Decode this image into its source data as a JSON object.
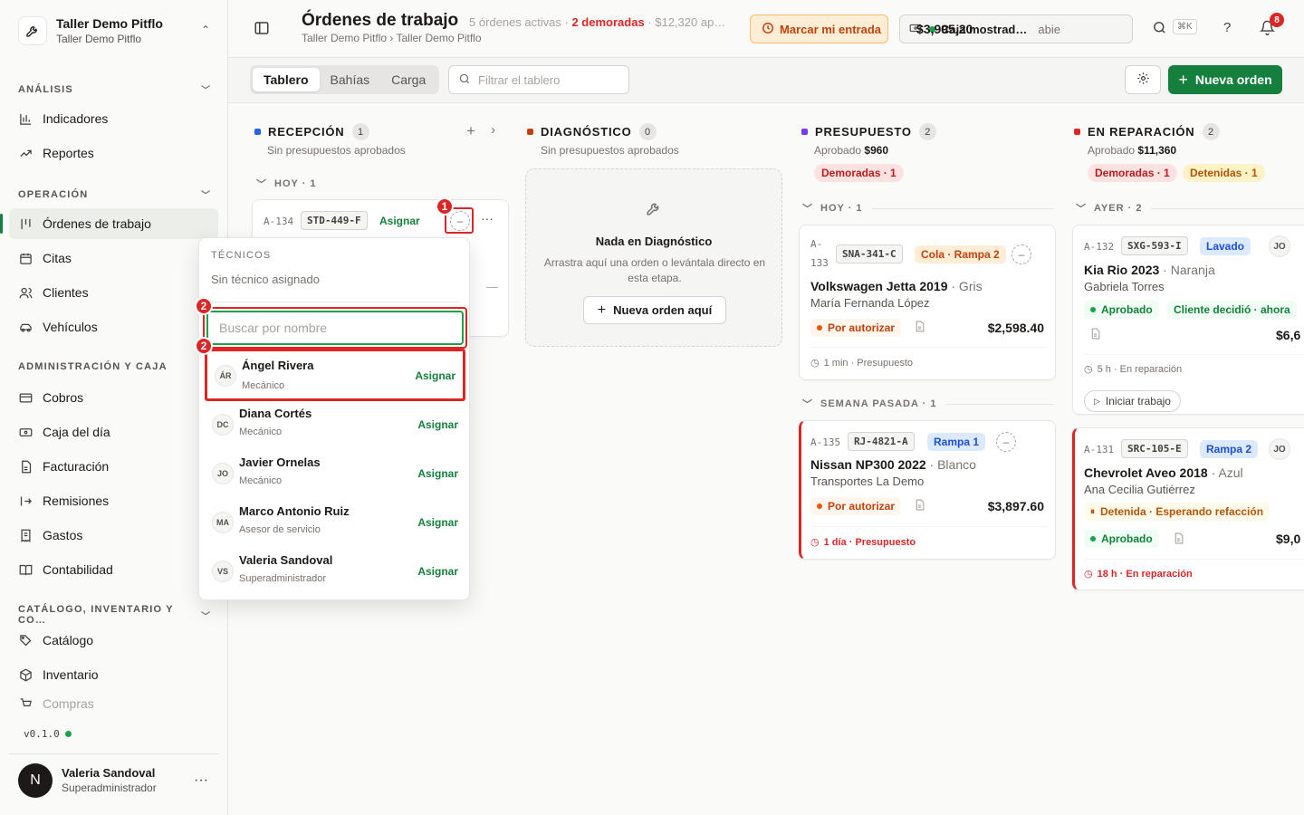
{
  "workspace": {
    "name": "Taller Demo Pitflo",
    "subname": "Taller Demo Pitflo"
  },
  "sidebar": {
    "sections": [
      {
        "label": "ANÁLISIS"
      },
      {
        "label": "OPERACIÓN"
      },
      {
        "label": "ADMINISTRACIÓN Y CAJA"
      },
      {
        "label": "CATÁLOGO, INVENTARIO Y CO…"
      }
    ],
    "items": [
      {
        "label": "Indicadores",
        "icon": "bar-chart-icon"
      },
      {
        "label": "Reportes",
        "icon": "trend-icon"
      },
      {
        "label": "Órdenes de trabajo",
        "icon": "kanban-icon",
        "active": true
      },
      {
        "label": "Citas",
        "icon": "calendar-icon"
      },
      {
        "label": "Clientes",
        "icon": "users-icon"
      },
      {
        "label": "Vehículos",
        "icon": "car-icon"
      },
      {
        "label": "Cobros",
        "icon": "card-icon"
      },
      {
        "label": "Caja del día",
        "icon": "cash-icon"
      },
      {
        "label": "Facturación",
        "icon": "file-icon"
      },
      {
        "label": "Remisiones",
        "icon": "export-icon"
      },
      {
        "label": "Gastos",
        "icon": "receipt-icon"
      },
      {
        "label": "Contabilidad",
        "icon": "book-icon"
      },
      {
        "label": "Catálogo",
        "icon": "tag-icon"
      },
      {
        "label": "Inventario",
        "icon": "box-icon"
      },
      {
        "label": "Compras",
        "icon": "cart-icon"
      }
    ],
    "version": "v0.1.0",
    "user": {
      "initial": "N",
      "name": "Valeria Sandoval",
      "role": "Superadministrador"
    }
  },
  "header": {
    "title": "Órdenes de trabajo",
    "meta_active": "5 órdenes activas ·",
    "meta_late": "2 demoradas",
    "meta_amount": "· $12,320 ap…",
    "breadcrumb": "Taller Demo Pitflo › Taller Demo Pitflo",
    "checkin_label": "Marcar mi entrada",
    "caja_name": "Caja mostrad…",
    "caja_status": "abie",
    "caja_amount": "$3,995.20",
    "kbd": "⌘K",
    "help": "?",
    "notifications": "8"
  },
  "toolbar": {
    "tabs": [
      "Tablero",
      "Bahías",
      "Carga"
    ],
    "filter_placeholder": "Filtrar el tablero",
    "new_label": "Nueva orden"
  },
  "columns": {
    "recepcion": {
      "title": "RECEPCIÓN",
      "count": "1",
      "sub": "Sin presupuestos aprobados",
      "color": "#2563eb",
      "group": "HOY · 1"
    },
    "diagnostico": {
      "title": "DIAGNÓSTICO",
      "count": "0",
      "sub": "Sin presupuestos aprobados",
      "color": "#c2410c",
      "empty_title": "Nada en Diagnóstico",
      "empty_text": "Arrastra aquí una orden o levántala directo en esta etapa.",
      "empty_button": "Nueva orden aquí"
    },
    "presupuesto": {
      "title": "PRESUPUESTO",
      "count": "2",
      "sub_prefix": "Aprobado",
      "sub_amount": "$960",
      "color": "#7c3aed",
      "pill_late": "Demoradas · 1",
      "group1": "HOY · 1",
      "group2": "SEMANA PASADA · 1"
    },
    "reparacion": {
      "title": "EN REPARACIÓN",
      "count": "2",
      "sub_prefix": "Aprobado",
      "sub_amount": "$11,360",
      "color": "#dc2626",
      "pill_late": "Demoradas · 1",
      "pill_held": "Detenidas · 1",
      "group1": "AYER · 2"
    }
  },
  "cards": {
    "a134": {
      "code": "A-134",
      "plate": "STD-449-F",
      "assign": "Asignar"
    },
    "a133": {
      "code_a": "A-",
      "code_b": "133",
      "plate": "SNA-341-C",
      "bay": "Cola · Rampa 2",
      "vehicle": "Volkswagen Jetta 2019",
      "color": "· Gris",
      "client": "María Fernanda López",
      "status": "Por autorizar",
      "amount": "$2,598.40",
      "footer": "1 min · Presupuesto"
    },
    "a135": {
      "code": "A-135",
      "plate": "RJ-4821-A",
      "bay": "Rampa 1",
      "vehicle": "Nissan NP300 2022",
      "color": "· Blanco",
      "client": "Transportes La Demo",
      "status": "Por autorizar",
      "amount": "$3,897.60",
      "footer": "1 día · Presupuesto"
    },
    "a132": {
      "code": "A-132",
      "plate": "SXG-593-I",
      "bay": "Lavado",
      "tech": "JO",
      "vehicle": "Kia Rio 2023",
      "color": "· Naranja",
      "client": "Gabriela Torres",
      "status": "Aprobado",
      "decision": "Cliente decidió · ahora",
      "amount": "$6,6",
      "footer": "5 h · En reparación",
      "action": "Iniciar trabajo"
    },
    "a131": {
      "code": "A-131",
      "plate": "SRC-105-E",
      "bay": "Rampa 2",
      "tech": "JO",
      "vehicle": "Chevrolet Aveo 2018",
      "color": "· Azul",
      "client": "Ana Cecilia Gutiérrez",
      "held": "Detenida · Esperando refacción",
      "status": "Aprobado",
      "amount": "$9,0",
      "footer": "18 h · En reparación"
    }
  },
  "popover": {
    "label": "TÉCNICOS",
    "none": "Sin técnico asignado",
    "search_placeholder": "Buscar por nombre",
    "techs": [
      {
        "initials": "ÁR",
        "name": "Ángel Rivera",
        "role": "Mecánico",
        "action": "Asignar"
      },
      {
        "initials": "DC",
        "name": "Diana Cortés",
        "role": "Mecánico",
        "action": "Asignar"
      },
      {
        "initials": "JO",
        "name": "Javier Ornelas",
        "role": "Mecánico",
        "action": "Asignar"
      },
      {
        "initials": "MA",
        "name": "Marco Antonio Ruiz",
        "role": "Asesor de servicio",
        "action": "Asignar"
      },
      {
        "initials": "VS",
        "name": "Valeria Sandoval",
        "role": "Superadministrador",
        "action": "Asignar"
      }
    ]
  },
  "markers": {
    "one": "1",
    "two": "2"
  }
}
